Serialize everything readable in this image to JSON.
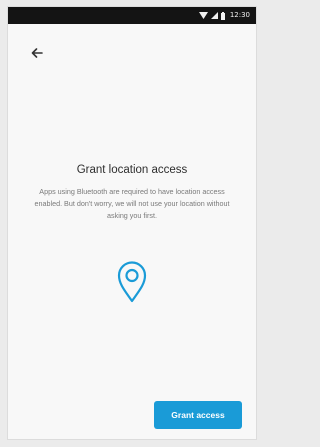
{
  "status_bar": {
    "time": "12:30",
    "icons": [
      "wifi-icon",
      "signal-icon",
      "battery-icon"
    ]
  },
  "navigation": {
    "back_icon": "arrow-left-icon"
  },
  "content": {
    "title": "Grant location access",
    "description": "Apps using Bluetooth are required to have location access enabled. But don't worry, we will not use your location without asking you first.",
    "illustration_icon": "location-pin-icon"
  },
  "actions": {
    "grant_label": "Grant access"
  },
  "colors": {
    "accent": "#1a9bd7",
    "status_bar": "#141414",
    "background": "#f8f8f8"
  }
}
